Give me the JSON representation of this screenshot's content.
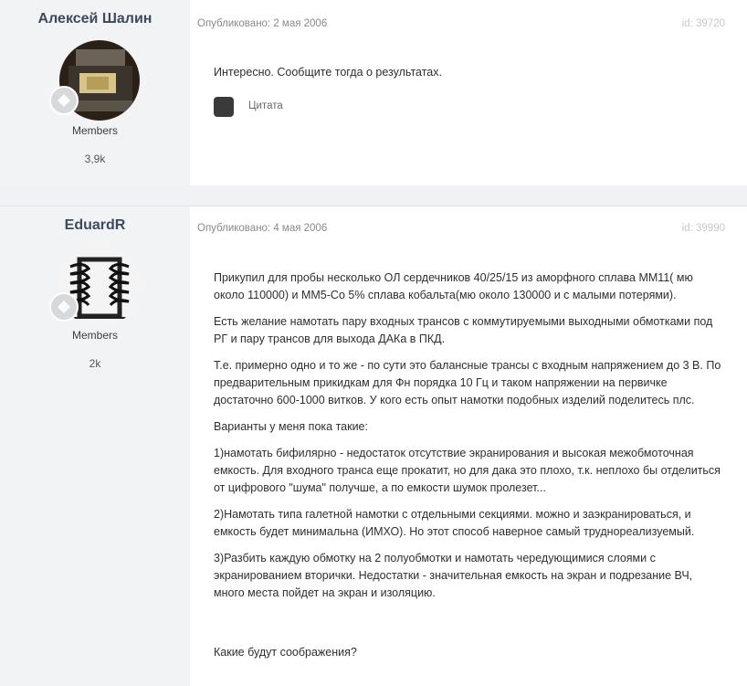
{
  "posts": [
    {
      "author": "Алексей Шалин",
      "group": "Members",
      "count": "3,9k",
      "meta": "Опубликовано: 2 мая 2006",
      "id": "id: 39720",
      "paragraphs": [
        "Интересно. Сообщите тогда о результатах."
      ],
      "quote_label": "Цитата"
    },
    {
      "author": "EduardR",
      "group": "Members",
      "count": "2k",
      "meta": "Опубликовано: 4 мая 2006",
      "id": "id: 39990",
      "paragraphs": [
        "Прикупил для пробы несколько ОЛ сердечников 40/25/15 из аморфного сплава ММ11( мю около 110000) и ММ5-Co 5% сплава кобальта(мю около 130000 и с малыми потерями).",
        "Есть желание намотать пару входных трансов с коммутируемыми выходными обмотками под РГ и пару трансов для выхода ДАКа в ПКД.",
        "Т.е. примерно одно и то же - по сути это балансные трансы с входным напряжением до 3 В. По предварительным прикидкам для Фн порядка 10 Гц и таком напряжении на первичке достаточно 600-1000 витков. У кого есть опыт намотки подобных изделий поделитесь плс.",
        "Варианты у меня пока такие:",
        "1)намотать бифилярно - недостаток отсутствие экранирования и высокая межобмоточная емкость. Для входного транса еще прокатит, но для дака это плохо, т.к. неплохо бы отделиться от цифрового \"шума\" получше, а по емкости шумок пролезет...",
        "2)Намотать типа галетной намотки с отдельными секциями. можно и заэкранироваться, и емкость будет минимальна (ИМХО). Но этот способ наверное самый труднореализуемый.",
        "3)Разбить каждую обмотку на 2 полуобмотки и намотать чередующимися слоями с экранированием вторички. Недостатки - значительная емкость на экран и подрезание ВЧ, много места пойдет на экран и изоляцию.",
        "Какие будут соображения?"
      ]
    }
  ],
  "icons": {
    "rank_badge": "rank-badge-icon",
    "avatar1": "transformer-photo",
    "avatar2": "coil-sketch"
  }
}
